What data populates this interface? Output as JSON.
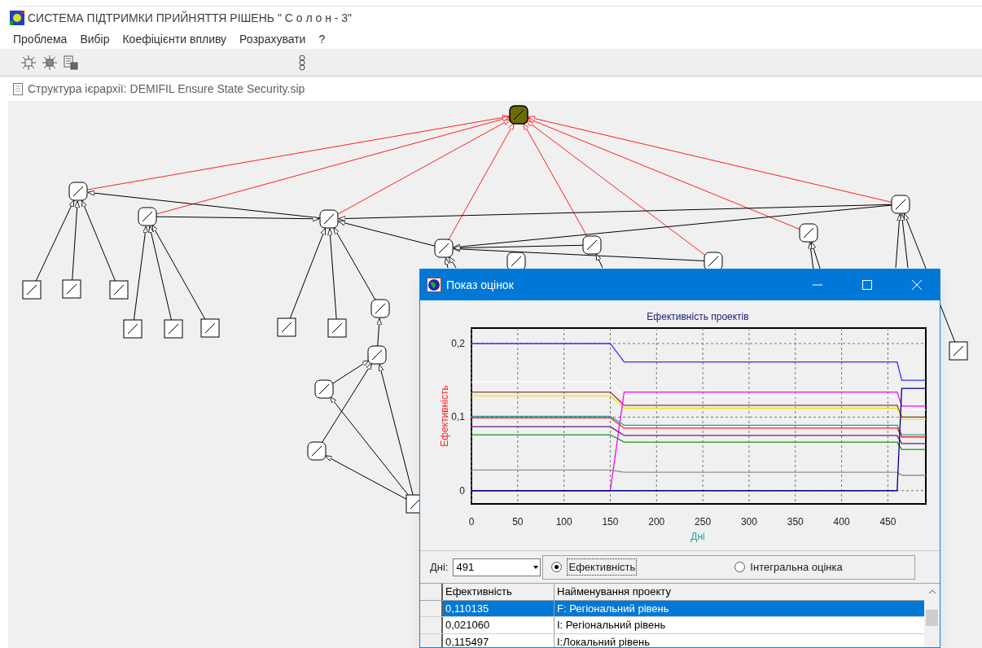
{
  "window": {
    "title": "СИСТЕМА ПІДТРИМКИ ПРИЙНЯТТЯ РІШЕНЬ \" С о л о н - 3\""
  },
  "menu": [
    "Проблема",
    "Вибір",
    "Коефіцієнти впливу",
    "Розрахувати",
    "?"
  ],
  "path_bar": {
    "text": "Структура ієрархії: DEMIFIL Ensure State Security.sip"
  },
  "dialog": {
    "title": "Показ оцінок",
    "chart_data": {
      "type": "line",
      "grid": true,
      "title": "Ефективність проектів",
      "xlabel": "Дні",
      "ylabel": "Ефективність",
      "x": [
        0,
        150,
        165,
        460,
        465,
        491
      ],
      "xlim": [
        0,
        491
      ],
      "ylim": [
        -0.018,
        0.221
      ],
      "xticks": [
        0,
        50,
        100,
        150,
        200,
        250,
        300,
        350,
        400,
        450
      ],
      "yticks": [
        {
          "value": 0,
          "label": "0"
        },
        {
          "value": 0.1,
          "label": "0,1"
        },
        {
          "value": 0.2,
          "label": "0,2"
        }
      ],
      "series": [
        {
          "color": "#3030ff",
          "values": [
            0.2,
            0.2,
            0.175,
            0.175,
            0.15,
            0.15
          ]
        },
        {
          "color": "#ffffff",
          "values": [
            0.148,
            0.148,
            0.128,
            0.128,
            0.11,
            0.11
          ]
        },
        {
          "color": "#8b3a3a",
          "values": [
            0.134,
            0.134,
            0.116,
            0.116,
            0.1,
            0.1
          ]
        },
        {
          "color": "#e8e800",
          "values": [
            0.129,
            0.129,
            0.112,
            0.112,
            0.097,
            0.097
          ]
        },
        {
          "color": "#ff00ff",
          "values": [
            0,
            0,
            0.134,
            0.134,
            0.115,
            0.115
          ]
        },
        {
          "color": "#20a0a0",
          "values": [
            0.101,
            0.101,
            0.089,
            0.089,
            0.076,
            0.076
          ]
        },
        {
          "color": "#ff2020",
          "values": [
            0.099,
            0.099,
            0.085,
            0.085,
            0.073,
            0.073
          ]
        },
        {
          "color": "#602080",
          "values": [
            0.087,
            0.087,
            0.075,
            0.075,
            0.064,
            0.064
          ]
        },
        {
          "color": "#209020",
          "values": [
            0.076,
            0.076,
            0.066,
            0.066,
            0.056,
            0.056
          ]
        },
        {
          "color": "#909090",
          "values": [
            0.028,
            0.028,
            0.025,
            0.025,
            0.021,
            0.021
          ]
        },
        {
          "color": "#000080",
          "values": [
            0,
            0,
            0,
            0,
            0.139,
            0.139
          ]
        }
      ]
    },
    "days": {
      "label": "Дні:",
      "value": "491"
    },
    "options": [
      {
        "label": "Ефективність",
        "selected": true
      },
      {
        "label": "Інтегральна оцінка",
        "selected": false
      }
    ],
    "table": {
      "columns": [
        "Ефективність",
        "Найменування проекту"
      ],
      "rows": [
        {
          "cells": [
            "0,110135",
            "F: Регіональний рівень"
          ],
          "selected": true
        },
        {
          "cells": [
            "0,021060",
            "I: Регіональний рівень"
          ],
          "selected": false
        },
        {
          "cells": [
            "0,115497",
            "I:Локальний рівень"
          ],
          "selected": false
        }
      ]
    }
  }
}
